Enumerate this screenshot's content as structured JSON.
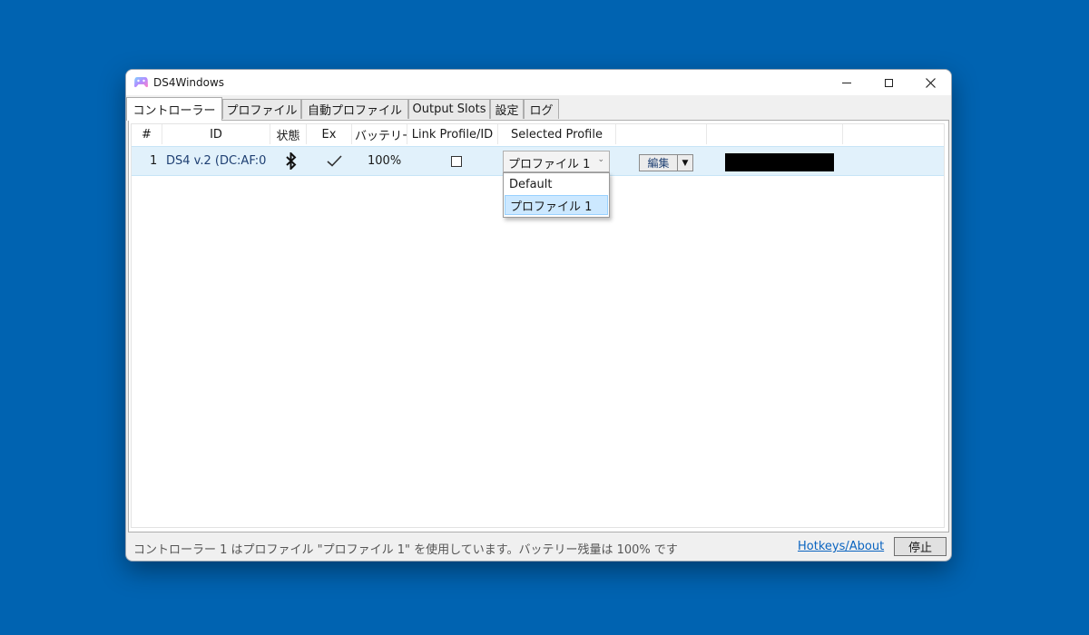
{
  "window": {
    "title": "DS4Windows"
  },
  "tabs": [
    {
      "label": "コントローラー"
    },
    {
      "label": "プロファイル"
    },
    {
      "label": "自動プロファイル"
    },
    {
      "label": "Output Slots"
    },
    {
      "label": "設定"
    },
    {
      "label": "ログ"
    }
  ],
  "table": {
    "headers": [
      "#",
      "ID",
      "状態",
      "Ex",
      "バッテリー",
      "Link Profile/ID",
      "Selected Profile",
      "",
      ""
    ],
    "rows": [
      {
        "index": "1",
        "id": "DS4 v.2 (DC:AF:0",
        "connection_icon": "bluetooth-icon",
        "exclusive_icon": "checkmark-icon",
        "battery": "100%",
        "link_profile_checked": false,
        "selected_profile": "プロファイル 1",
        "edit_label": "編集",
        "lightbar_color": "#000000"
      }
    ]
  },
  "profile_dropdown": {
    "options": [
      "Default",
      "プロファイル 1"
    ],
    "selected": "プロファイル 1"
  },
  "status": {
    "text": "コントローラー 1 はプロファイル \"プロファイル 1\" を使用しています。バッテリー残量は 100% です",
    "hotkeys_label": "Hotkeys/About",
    "stop_label": "停止"
  },
  "colors": {
    "desktop": "#0063b1",
    "selected_row": "#e1f1fb",
    "link": "#0a64c0"
  }
}
